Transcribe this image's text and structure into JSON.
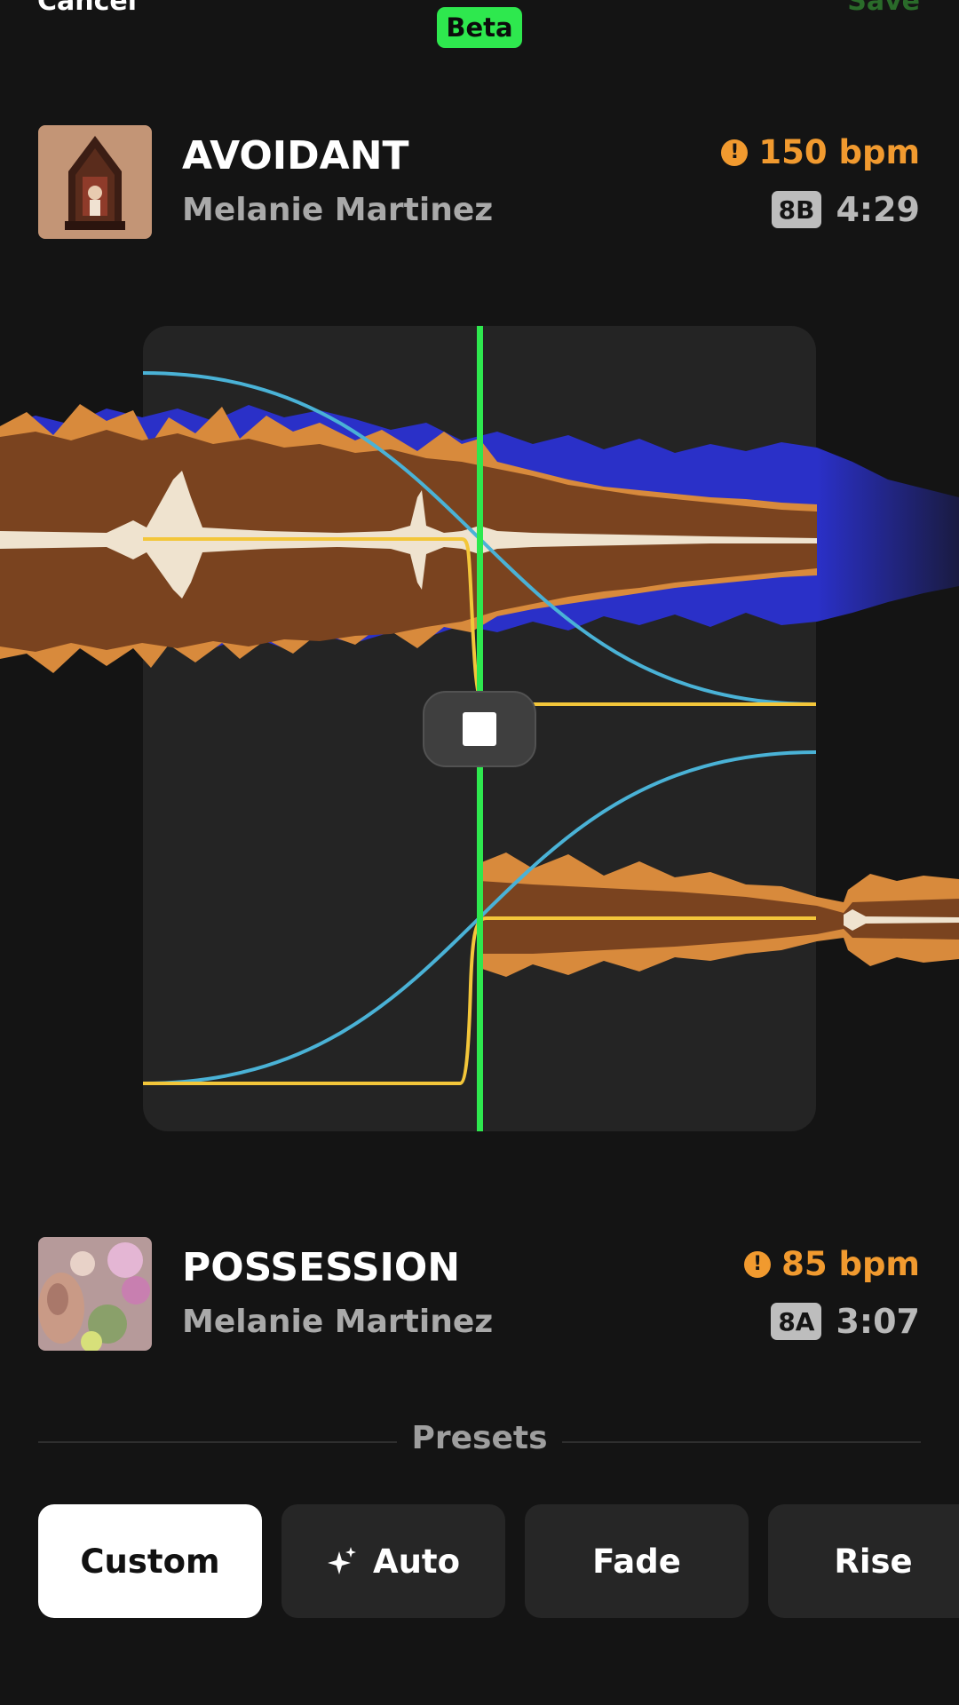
{
  "topbar": {
    "cancel_label": "Cancel",
    "save_label": "Save",
    "beta_label": "Beta"
  },
  "track_out": {
    "title": "AVOIDANT",
    "artist": "Melanie Martinez",
    "bpm": "150 bpm",
    "key": "8B",
    "duration": "4:29"
  },
  "track_in": {
    "title": "POSSESSION",
    "artist": "Melanie Martinez",
    "bpm": "85 bpm",
    "key": "8A",
    "duration": "3:07"
  },
  "mixer": {
    "transport_icon": "stop-icon",
    "colors": {
      "waveform_low": "#2a30c8",
      "waveform_mid": "#d88a3c",
      "waveform_body": "#7a431f",
      "waveform_high": "#efe3cf",
      "volume_curve": "#4ab2d6",
      "eq_curve": "#f3c63a",
      "playhead": "#2ee84e"
    }
  },
  "presets": {
    "label": "Presets",
    "items": [
      {
        "label": "Custom",
        "active": true
      },
      {
        "label": "Auto",
        "icon": "sparkle-icon"
      },
      {
        "label": "Fade"
      },
      {
        "label": "Rise"
      }
    ]
  },
  "colors": {
    "accent": "#2ee84e",
    "warning": "#f19a2f",
    "background": "#141414"
  }
}
